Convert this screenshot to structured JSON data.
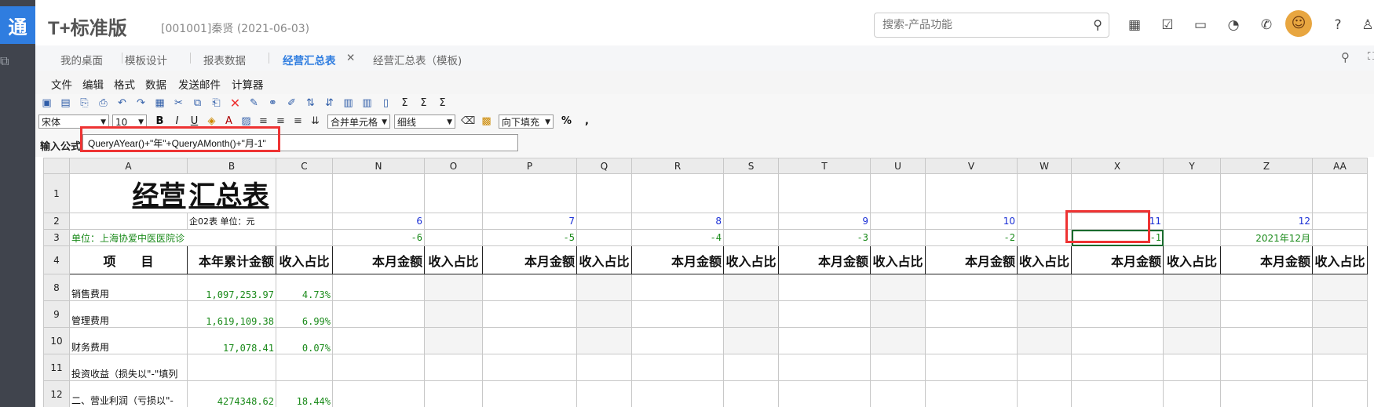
{
  "app": {
    "logo": "通",
    "brand": "T+标准版",
    "company": "[001001]秦贤  (2021-06-03)",
    "search_placeholder": "搜索-产品功能"
  },
  "top_icons": [
    "calculator-icon",
    "checklist-icon",
    "message-icon",
    "bell-icon",
    "phone-icon",
    "help-icon",
    "user-icon"
  ],
  "tabs": [
    {
      "label": "我的桌面"
    },
    {
      "label": "模板设计"
    },
    {
      "label": "报表数据"
    },
    {
      "label": "经营汇总表",
      "active": true,
      "close": "✕"
    },
    {
      "label": "经营汇总表（模板)"
    }
  ],
  "menu": [
    "文件",
    "编辑",
    "格式",
    "数据",
    "发送邮件",
    "计算器"
  ],
  "toolbar": {
    "font": "宋体",
    "size": "10",
    "merge": "合并单元格",
    "border": "细线",
    "fill": "向下填充",
    "percent": "%",
    "comma": ","
  },
  "formula": {
    "label": "输入公式",
    "value": "QueryAYear()+\"年\"+QueryAMonth()+\"月-1\""
  },
  "sheet": {
    "columns": [
      "A",
      "B",
      "C",
      "N",
      "O",
      "P",
      "Q",
      "R",
      "S",
      "T",
      "U",
      "V",
      "W",
      "X",
      "Y",
      "Z",
      "AA"
    ],
    "title_a": "经营",
    "title_b": "汇总表",
    "row2_b": "企02表 单位：元",
    "row2_nums": [
      "6",
      "7",
      "8",
      "9",
      "10",
      "11",
      "12"
    ],
    "row3_a": "单位：上海协爱中医医院诊",
    "row3_nums": [
      "-6",
      "-5",
      "-4",
      "-3",
      "-2",
      "-1"
    ],
    "row3_z": "2021年12月",
    "hdr_item": "项　　目",
    "hdr_ytd": "本年累计金额",
    "hdr_ratio": "收入占比",
    "hdr_month": "本月金额",
    "rows": [
      {
        "num": "8",
        "label": "销售费用",
        "ytd": "1,097,253.97",
        "ratio": "4.73%"
      },
      {
        "num": "9",
        "label": "管理费用",
        "ytd": "1,619,109.38",
        "ratio": "6.99%"
      },
      {
        "num": "10",
        "label": "财务费用",
        "ytd": "17,078.41",
        "ratio": "0.07%"
      },
      {
        "num": "11",
        "label": "投资收益（损失以\"-\"填列",
        "ytd": "",
        "ratio": ""
      },
      {
        "num": "12",
        "label": "二、营业利润（亏损以\"-",
        "ytd": "4274348.62",
        "ratio": "18.44%"
      }
    ]
  }
}
